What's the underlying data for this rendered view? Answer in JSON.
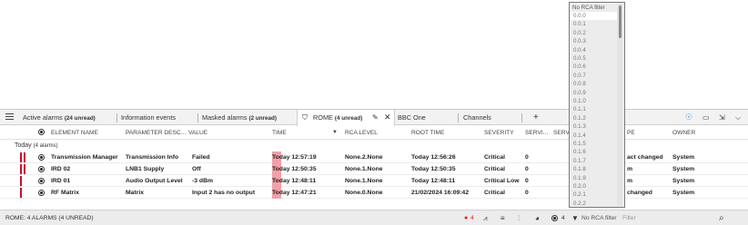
{
  "tabs": [
    {
      "label": "Active alarms ",
      "unread": "(24 unread)"
    },
    {
      "label": "Information events",
      "unread": ""
    },
    {
      "label": "Masked alarms ",
      "unread": "(2 unread)"
    },
    {
      "label": "ROME ",
      "unread": "(4 unread)"
    },
    {
      "label": "BBC One",
      "unread": ""
    },
    {
      "label": "Channels",
      "unread": ""
    }
  ],
  "columns": {
    "element_name": "ELEMENT NAME",
    "parameter_desc": "PARAMETER DESC...",
    "value": "VALUE",
    "time": "TIME",
    "rca_level": "RCA LEVEL",
    "root_time": "ROOT TIME",
    "severity": "SEVERITY",
    "service": "SERVI...",
    "service2": "SERVI",
    "type": "PE",
    "owner": "OWNER"
  },
  "group": {
    "label": "Today",
    "count": "(4 alarms)"
  },
  "rows": [
    {
      "element": "Transmission Manager",
      "parameter": "Transmission Info",
      "value": "Failed",
      "time": "Today 12:57:19",
      "rca": "None.2.None",
      "root_time": "Today 12:56:26",
      "severity": "Critical",
      "service": "0",
      "type": "act changed",
      "owner": "System"
    },
    {
      "element": "IRD 02",
      "parameter": "LNB1 Supply",
      "value": "Off",
      "time": "Today 12:50:35",
      "rca": "None.1.None",
      "root_time": "Today 12:50:35",
      "severity": "Critical",
      "service": "0",
      "type": "m",
      "owner": "System"
    },
    {
      "element": "IRD 01",
      "parameter": "Audio Output Level",
      "value": "-3 dBm",
      "time": "Today 12:48:11",
      "rca": "None.1.None",
      "root_time": "Today 12:48:11",
      "severity": "Critical Low",
      "service": "0",
      "type": "m",
      "owner": "System"
    },
    {
      "element": "RF Matrix",
      "parameter": "Matrix",
      "value": "Input 2 has no output",
      "time": "Today 12:47:21",
      "rca": "None.0.None",
      "root_time": "21/02/2024 16:09:42",
      "severity": "Critical",
      "service": "0",
      "type": "changed",
      "owner": "System"
    }
  ],
  "status": {
    "text": "ROME: 4 ALARMS (4 UNREAD)",
    "alarm_count": "4",
    "radio_count": "4",
    "rca_filter": "No RCA filter",
    "filter_placeholder": "Filter"
  },
  "rca_dropdown": {
    "header": "No RCA filter",
    "items": [
      "0.0.0",
      "0.0.1",
      "0.0.2",
      "0.0.3",
      "0.0.4",
      "0.0.5",
      "0.0.6",
      "0.0.7",
      "0.0.8",
      "0.0.9",
      "0.1.0",
      "0.1.1",
      "0.1.2",
      "0.1.3",
      "0.1.4",
      "0.1.5",
      "0.1.6",
      "0.1.7",
      "0.1.8",
      "0.1.9",
      "0.2.0",
      "0.2.1",
      "0.2.2",
      "0.2.3"
    ],
    "selected_index": 0
  },
  "colors": {
    "critical": "#c8102e",
    "time_highlight": "#f1a0a8"
  }
}
